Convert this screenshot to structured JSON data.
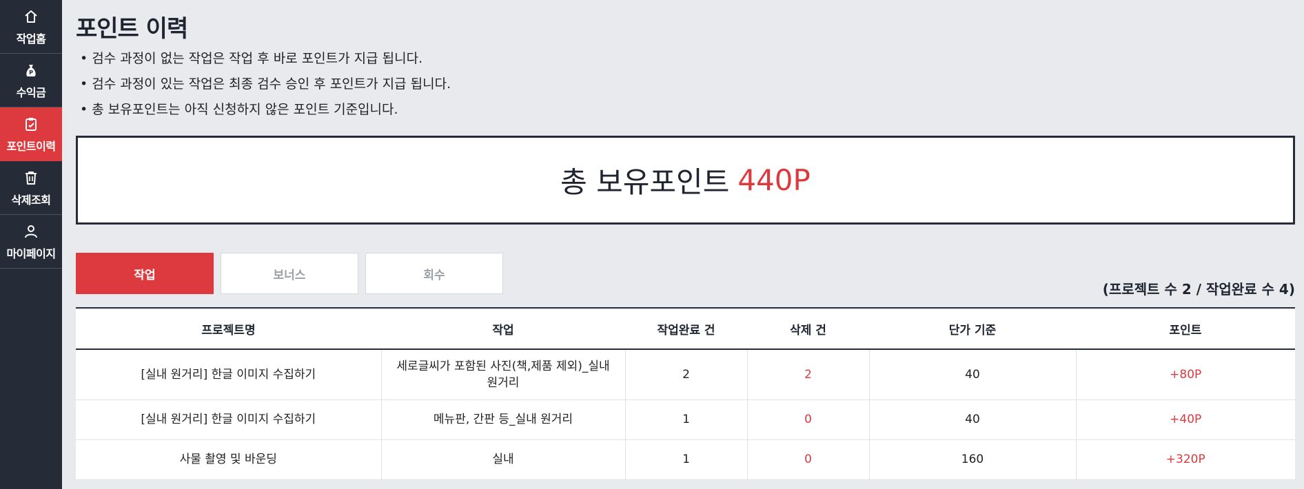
{
  "sidebar": {
    "items": [
      {
        "label": "작업홈",
        "icon": "home-icon"
      },
      {
        "label": "수익금",
        "icon": "money-bag-icon"
      },
      {
        "label": "포인트이력",
        "icon": "clipboard-check-icon",
        "active": true
      },
      {
        "label": "삭제조회",
        "icon": "trash-icon"
      },
      {
        "label": "마이페이지",
        "icon": "user-icon"
      }
    ]
  },
  "page": {
    "title": "포인트 이력",
    "notes": [
      "검수 과정이 없는 작업은 작업 후 바로 포인트가 지급 됩니다.",
      "검수 과정이 있는 작업은 최종 검수 승인 후 포인트가 지급 됩니다.",
      "총 보유포인트는 아직 신청하지 않은 포인트 기준입니다."
    ]
  },
  "total": {
    "label": "총 보유포인트",
    "value": "440P"
  },
  "tabs": [
    {
      "label": "작업",
      "active": true
    },
    {
      "label": "보너스",
      "active": false
    },
    {
      "label": "회수",
      "active": false
    }
  ],
  "summary": "(프로젝트 수 2 / 작업완료 수 4)",
  "table": {
    "headers": [
      "프로젝트명",
      "작업",
      "작업완료 건",
      "삭제 건",
      "단가 기준",
      "포인트"
    ],
    "rows": [
      [
        "[실내 원거리] 한글 이미지 수집하기",
        "세로글씨가 포함된 사진(책,제품 제외)_실내 원거리",
        "2",
        "2",
        "40",
        "+80P"
      ],
      [
        "[실내 원거리] 한글 이미지 수집하기",
        "메뉴판, 간판 등_실내 원거리",
        "1",
        "0",
        "40",
        "+40P"
      ],
      [
        "사물 촬영 및 바운딩",
        "실내",
        "1",
        "0",
        "160",
        "+320P"
      ]
    ]
  },
  "colors": {
    "accent": "#dc3a3e",
    "sidebar": "#252c37",
    "background": "#e8eaed"
  }
}
